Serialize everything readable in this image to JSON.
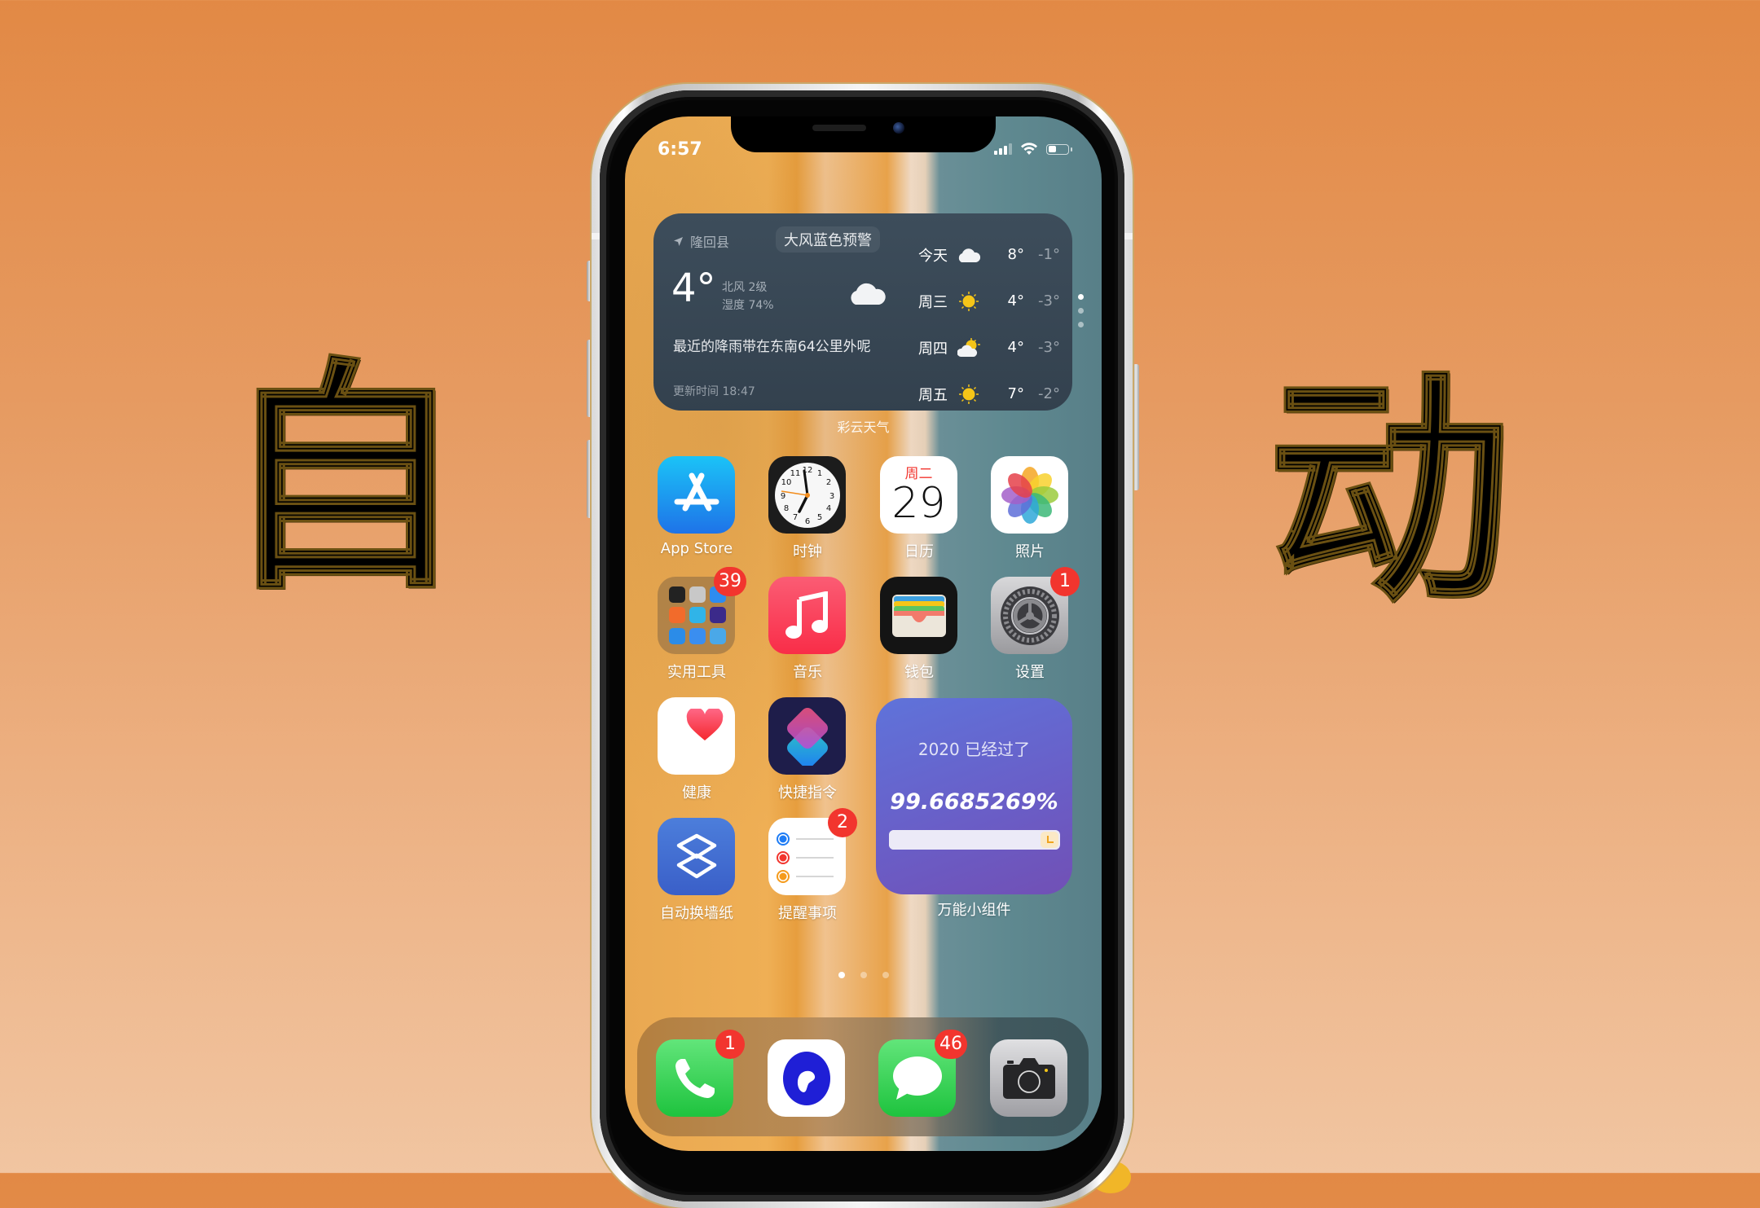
{
  "overlay_text": {
    "left": "自",
    "right": "动"
  },
  "status_bar": {
    "time": "6:57",
    "signal_bars": 3,
    "signal_max": 4,
    "wifi": "wifi-icon",
    "battery_percent": 40
  },
  "weather_widget": {
    "location": "隆回县",
    "alert": "大风蓝色预警",
    "current_temp": "4°",
    "wind": "北风 2级",
    "humidity": "湿度 74%",
    "current_icon": "cloud-icon",
    "description": "最近的降雨带在东南64公里外呢",
    "updated": "更新时间  18:47",
    "forecast": [
      {
        "day": "今天",
        "icon": "cloud-icon",
        "high": "8°",
        "low": "-1°"
      },
      {
        "day": "周三",
        "icon": "sun-icon",
        "high": "4°",
        "low": "-3°"
      },
      {
        "day": "周四",
        "icon": "partly-cloudy-icon",
        "high": "4°",
        "low": "-3°"
      },
      {
        "day": "周五",
        "icon": "sun-icon",
        "high": "7°",
        "low": "-2°"
      }
    ],
    "app_label": "彩云天气",
    "stack_pages": 3,
    "stack_active": 0
  },
  "apps": [
    {
      "label": "App Store",
      "icon": "app-store-icon",
      "badge": null
    },
    {
      "label": "时钟",
      "icon": "clock-icon",
      "badge": null
    },
    {
      "label": "日历",
      "icon": "calendar-icon",
      "badge": null,
      "weekday": "周二",
      "date": "29"
    },
    {
      "label": "照片",
      "icon": "photos-icon",
      "badge": null
    },
    {
      "label": "实用工具",
      "icon": "folder-icon",
      "badge": "39"
    },
    {
      "label": "音乐",
      "icon": "music-icon",
      "badge": null
    },
    {
      "label": "钱包",
      "icon": "wallet-icon",
      "badge": null
    },
    {
      "label": "设置",
      "icon": "settings-icon",
      "badge": "1"
    },
    {
      "label": "健康",
      "icon": "health-icon",
      "badge": null
    },
    {
      "label": "快捷指令",
      "icon": "shortcuts-icon",
      "badge": null
    },
    {
      "label": "自动换墙纸",
      "icon": "layers-icon",
      "badge": null
    },
    {
      "label": "提醒事项",
      "icon": "reminders-icon",
      "badge": "2"
    }
  ],
  "progress_widget": {
    "title": "2020 已经过了",
    "value_text": "99.6685269%",
    "progress": 0.996685269,
    "label": "万能小组件"
  },
  "page_indicator": {
    "pages": 3,
    "active": 0
  },
  "dock": [
    {
      "name": "phone",
      "icon": "phone-icon",
      "badge": "1"
    },
    {
      "name": "quark",
      "icon": "quark-browser-icon",
      "badge": null
    },
    {
      "name": "messages",
      "icon": "messages-icon",
      "badge": "46"
    },
    {
      "name": "camera",
      "icon": "camera-icon",
      "badge": null
    }
  ],
  "colors": {
    "badge": "#F2352E",
    "weather_bg": "#36444F",
    "progress_widget": "#6A5DC6"
  }
}
